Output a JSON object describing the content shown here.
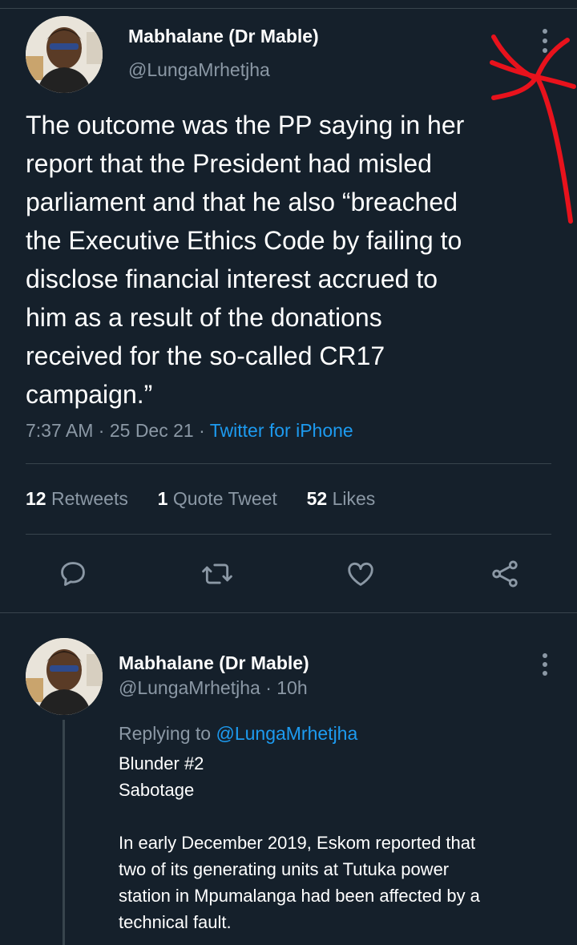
{
  "colors": {
    "background": "#15202b",
    "text": "#ffffff",
    "muted": "#8b98a5",
    "accent": "#1d9bf0",
    "divider": "#38444d",
    "annotation": "#e8121c"
  },
  "main_tweet": {
    "author_name": "Mabhalane (Dr Mable)",
    "author_handle": "@LungaMrhetjha",
    "text_lines": [
      "The outcome was the PP saying in her",
      "report that the President had misled",
      "parliament and that he also “breached",
      "the Executive Ethics Code by failing to",
      "disclose financial interest accrued to",
      "him as a result of the donations",
      "received for the so-called CR17",
      "campaign.”"
    ],
    "time": "7:37 AM",
    "date": "25 Dec 21",
    "separator": "·",
    "source": "Twitter for iPhone",
    "stats": {
      "retweets_count": "12",
      "retweets_label": "Retweets",
      "quotes_count": "1",
      "quotes_label": "Quote Tweet",
      "likes_count": "52",
      "likes_label": "Likes"
    },
    "actions": [
      "reply-icon",
      "retweet-icon",
      "like-icon",
      "share-icon"
    ]
  },
  "reply_tweet": {
    "author_name": "Mabhalane (Dr Mable)",
    "author_handle": "@LungaMrhetjha",
    "time_ago": "· 10h",
    "replying_prefix": "Replying to",
    "replying_handle": "@LungaMrhetjha",
    "text_lines": [
      "Blunder #2",
      "Sabotage",
      "",
      "In early December 2019, Eskom reported that",
      "two of its generating units at Tutuka power",
      "station in Mpumalanga had been affected by a",
      "technical fault."
    ]
  }
}
